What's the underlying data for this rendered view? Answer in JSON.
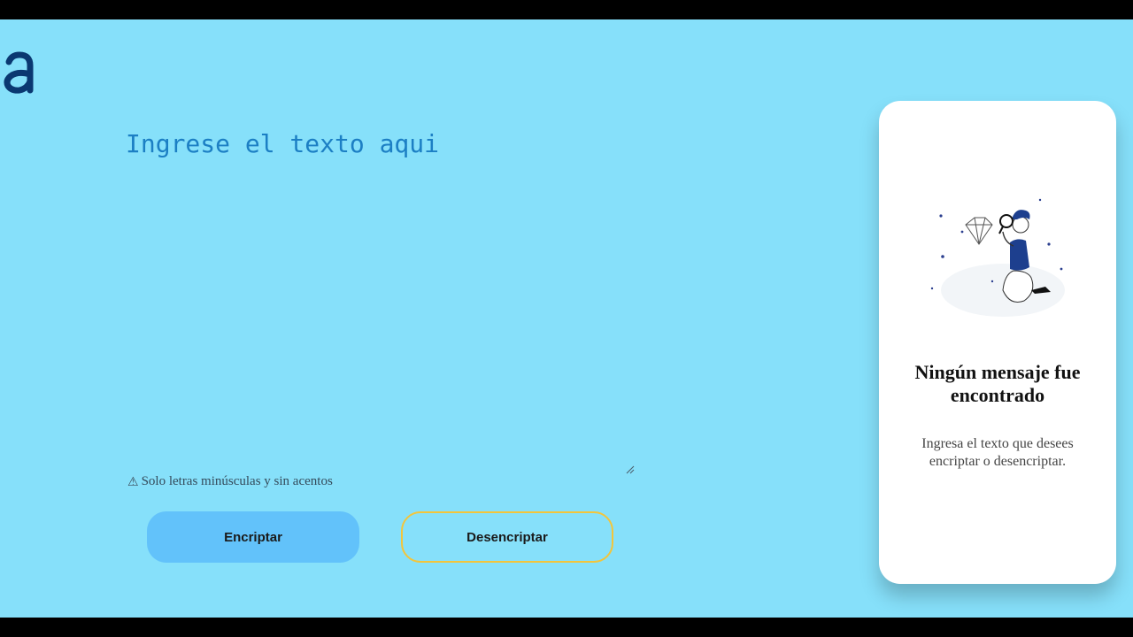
{
  "app": {
    "logo_letter": "a",
    "input": {
      "placeholder": "Ingrese el texto aqui",
      "value": ""
    },
    "hint": {
      "icon": "warning-icon",
      "text": "Solo letras minúsculas y sin acentos"
    },
    "buttons": {
      "encrypt_label": "Encriptar",
      "decrypt_label": "Desencriptar"
    },
    "output_card": {
      "title": "Ningún mensaje fue encontrado",
      "text": "Ingresa el texto que desees encriptar o desencriptar.",
      "illustration": "person-with-magnifying-glass-illustration"
    }
  },
  "colors": {
    "background": "#86e0fa",
    "logo": "#0a3871",
    "placeholder": "#1c7fc4",
    "encrypt_button": "#62c2fa",
    "decrypt_border": "#f3c53b",
    "card": "#ffffff"
  }
}
